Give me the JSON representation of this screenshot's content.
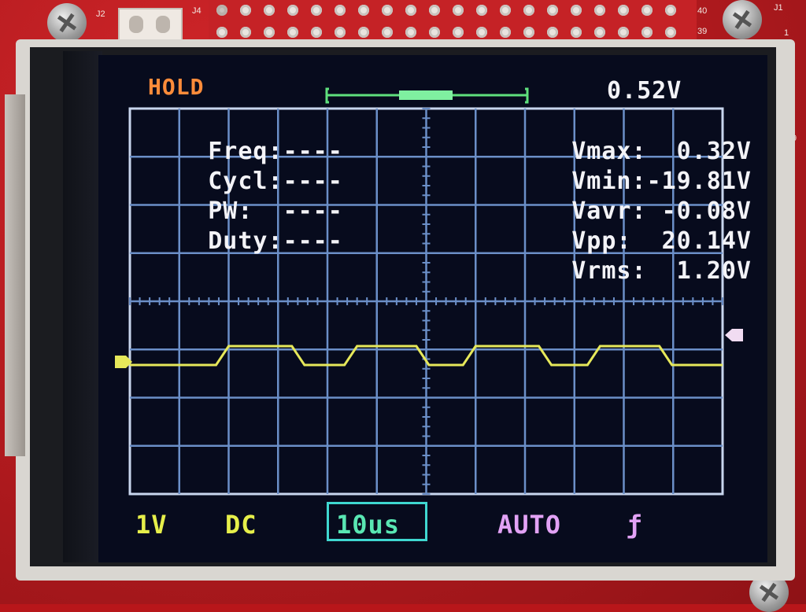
{
  "board": {
    "silk_j2": "J2",
    "silk_j4": "J4",
    "silk_j1": "J1",
    "silk_40": "40",
    "silk_39": "39",
    "silk_1": "1",
    "silk_9": "9"
  },
  "status": {
    "hold": "HOLD",
    "trigger_level": "0.52V"
  },
  "measurements_left": [
    {
      "label": "Freq:",
      "value": "----"
    },
    {
      "label": "Cycl:",
      "value": "----"
    },
    {
      "label": "PW:  ",
      "value": "----"
    },
    {
      "label": "Duty:",
      "value": "----"
    }
  ],
  "measurements_right": [
    {
      "label": "Vmax:",
      "value": "  0.32V"
    },
    {
      "label": "Vmin:",
      "value": "-19.81V"
    },
    {
      "label": "Vavr:",
      "value": " -0.08V"
    },
    {
      "label": "Vpp: ",
      "value": " 20.14V"
    },
    {
      "label": "Vrms:",
      "value": "  1.20V"
    }
  ],
  "bottom_bar": {
    "volts_div": "1V",
    "coupling": "DC",
    "time_div": "10us",
    "trigger_mode": "AUTO",
    "trigger_edge": "ƒ"
  },
  "colors": {
    "grid": "#6b8fc8",
    "trace": "#e6e85a",
    "hold": "#ff8c3a",
    "volts_div": "#e6ef4a",
    "coupling": "#e6ef4a",
    "time_div": "#59e6b3",
    "time_div_box": "#3fd7d0",
    "trigger_mode": "#e2a2f5",
    "trigger_edge": "#e2a2f5",
    "trigger_marker": "#f1dcf2",
    "timeline": "#5fe07d"
  },
  "trace": {
    "shape": "square-wave",
    "levels": {
      "low": -0.1,
      "high": 0.3
    },
    "units": "div",
    "edge_times": [
      2.5,
      4.1,
      5.75,
      7.25,
      8.75,
      10.35,
      11.9,
      13.4
    ],
    "record_divisions": 15
  }
}
